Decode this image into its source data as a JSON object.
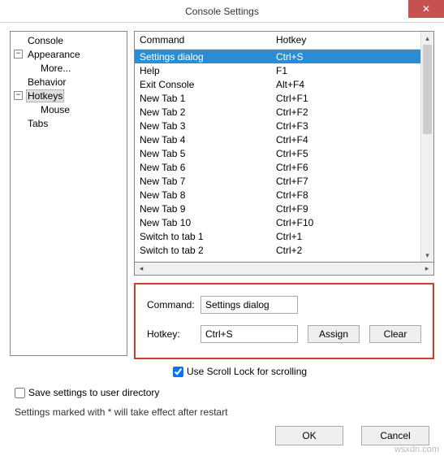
{
  "title": "Console Settings",
  "tree": {
    "console": "Console",
    "appearance": "Appearance",
    "more": "More...",
    "behavior": "Behavior",
    "hotkeys": "Hotkeys",
    "mouse": "Mouse",
    "tabs": "Tabs"
  },
  "list": {
    "head_command": "Command",
    "head_hotkey": "Hotkey",
    "rows": [
      {
        "c": "Settings dialog",
        "h": "Ctrl+S"
      },
      {
        "c": "Help",
        "h": "F1"
      },
      {
        "c": "Exit Console",
        "h": "Alt+F4"
      },
      {
        "c": "New Tab 1",
        "h": "Ctrl+F1"
      },
      {
        "c": "New Tab 2",
        "h": "Ctrl+F2"
      },
      {
        "c": "New Tab 3",
        "h": "Ctrl+F3"
      },
      {
        "c": "New Tab 4",
        "h": "Ctrl+F4"
      },
      {
        "c": "New Tab 5",
        "h": "Ctrl+F5"
      },
      {
        "c": "New Tab 6",
        "h": "Ctrl+F6"
      },
      {
        "c": "New Tab 7",
        "h": "Ctrl+F7"
      },
      {
        "c": "New Tab 8",
        "h": "Ctrl+F8"
      },
      {
        "c": "New Tab 9",
        "h": "Ctrl+F9"
      },
      {
        "c": "New Tab 10",
        "h": "Ctrl+F10"
      },
      {
        "c": "Switch to tab 1",
        "h": "Ctrl+1"
      },
      {
        "c": "Switch to tab 2",
        "h": "Ctrl+2"
      }
    ]
  },
  "form": {
    "command_label": "Command:",
    "command_value": "Settings dialog",
    "hotkey_label": "Hotkey:",
    "hotkey_value": "Ctrl+S",
    "assign": "Assign",
    "clear": "Clear"
  },
  "scroll_lock": "Use Scroll Lock for scrolling",
  "save_user_dir": "Save settings to user directory",
  "restart_note": "Settings marked with * will take effect after restart",
  "ok": "OK",
  "cancel": "Cancel",
  "watermark": "wsxdn.com"
}
